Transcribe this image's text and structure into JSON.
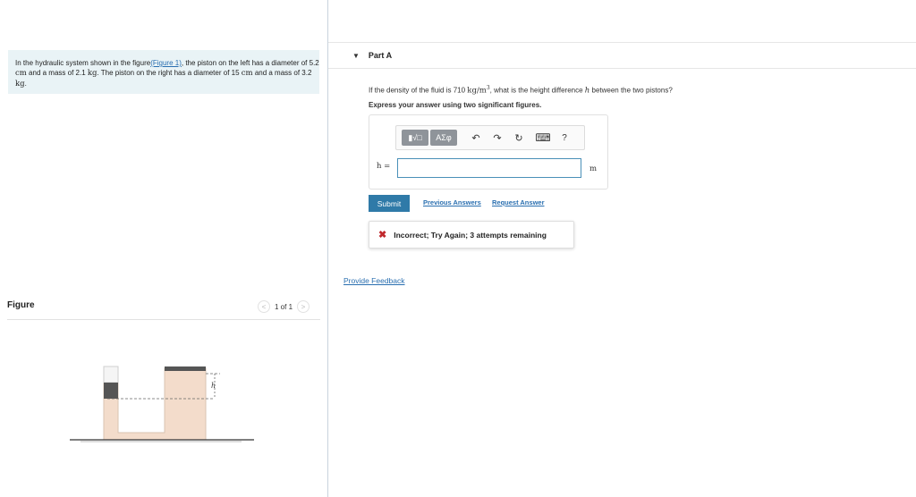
{
  "problem": {
    "text_before_link": "In the hydraulic system shown in the figure",
    "link": "(Figure 1)",
    "text_1": ", the piston on the left has a diameter of 5.2 ",
    "unit_cm_1": "cm",
    "text_2": " and a mass of 2.1 ",
    "unit_kg_1": "kg",
    "text_3": ". The piston on the right has a diameter of 15 ",
    "unit_cm_2": "cm",
    "text_4": " and a mass of 3.2 ",
    "unit_kg_2": "kg",
    "text_5": "."
  },
  "figure": {
    "label": "Figure",
    "pager_prev": "<",
    "pager_text": "1 of 1",
    "pager_next": ">",
    "h_label": "h"
  },
  "part": {
    "caret": "▼",
    "title": "Part A"
  },
  "question": {
    "text_1": "If the density of the fluid is 710 ",
    "unit": "kg/m",
    "unit_exp": "3",
    "text_2": ", what is the height difference ",
    "var": "h",
    "text_3": " between the two pistons?"
  },
  "instruction": "Express your answer using two significant figures.",
  "toolbar": {
    "template_label": "▮√□",
    "symbols_label": "ΑΣφ",
    "undo_icon": "↶",
    "redo_icon": "↷",
    "reset_icon": "↻",
    "keyboard_icon": "⌨",
    "help_label": "?"
  },
  "answer": {
    "label": "h =",
    "value": "",
    "unit": "m"
  },
  "submit_label": "Submit",
  "previous_answers_label": "Previous Answers",
  "request_answer_label": "Request Answer",
  "feedback": {
    "icon": "✖",
    "text": "Incorrect; Try Again; 3 attempts remaining"
  },
  "provide_feedback_label": "Provide Feedback"
}
